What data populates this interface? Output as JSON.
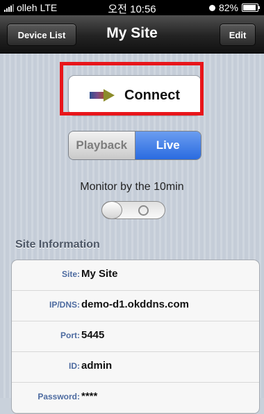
{
  "status_bar": {
    "carrier": "olleh",
    "network": "LTE",
    "time": "오전 10:56",
    "battery": "82%"
  },
  "nav": {
    "back_label": "Device List",
    "title": "My Site",
    "edit_label": "Edit"
  },
  "connect": {
    "label": "Connect"
  },
  "mode": {
    "options": [
      "Playback",
      "Live"
    ],
    "selected": "Live"
  },
  "monitor": {
    "label": "Monitor by the 10min",
    "toggle_state": "off"
  },
  "site_info": {
    "header": "Site Information",
    "rows": [
      {
        "key": "Site:",
        "value": "My Site"
      },
      {
        "key": "IP/DNS:",
        "value": "demo-d1.okddns.com"
      },
      {
        "key": "Port:",
        "value": "5445"
      },
      {
        "key": "ID:",
        "value": "admin"
      },
      {
        "key": "Password:",
        "value": "****"
      }
    ]
  }
}
